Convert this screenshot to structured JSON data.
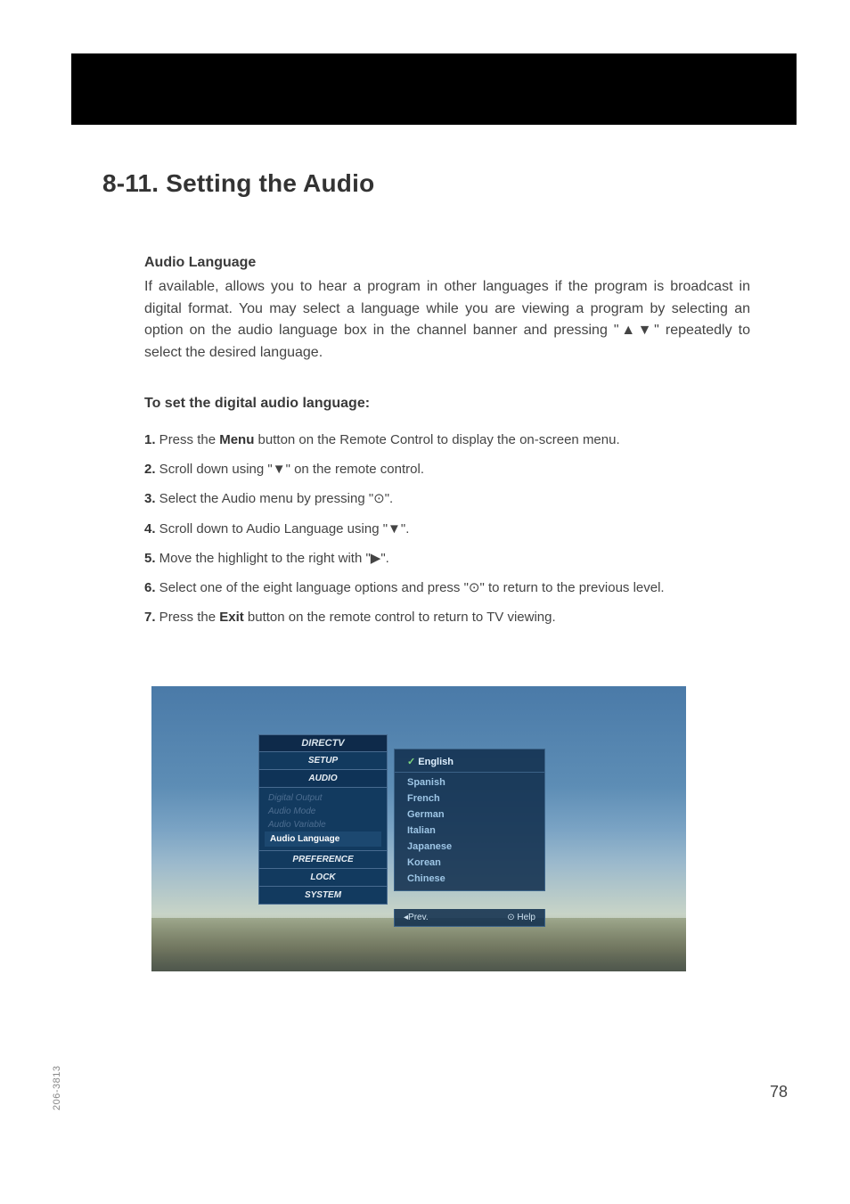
{
  "heading": "8-11. Setting the Audio",
  "section": {
    "title": "Audio Language",
    "para": "If available, allows you to hear a program in other languages if the program is broadcast in digital format.  You may select a language while you are viewing a program by selecting an option on the audio language box in the channel banner and pressing \"▲▼\" repeatedly to select the desired language.",
    "subhead": "To set the digital audio language:"
  },
  "steps": {
    "s1a": "1.",
    "s1b": " Press the ",
    "s1c": "Menu",
    "s1d": " button on the Remote Control to display the on-screen menu.",
    "s2a": "2.",
    "s2b": " Scroll down using \"▼\" on the remote control.",
    "s3a": "3.",
    "s3b": " Select the Audio menu by pressing \"⊙\".",
    "s4a": "4.",
    "s4b": " Scroll down to Audio Language using \"▼\".",
    "s5a": "5.",
    "s5b": " Move the highlight to the right with \"▶\".",
    "s6a": "6.",
    "s6b": " Select one of the eight language options and press \"⊙\" to return to the previous level.",
    "s7a": "7.",
    "s7b": " Press the ",
    "s7c": "Exit",
    "s7d": " button on the remote control to return to TV viewing."
  },
  "osd": {
    "menu": {
      "head": "DIRECTV",
      "setup": "SETUP",
      "audio": "AUDIO",
      "sub1": "Digital Output",
      "sub2": "Audio Mode",
      "sub3": "Audio Variable",
      "sub4": "Audio Language",
      "pref": "PREFERENCE",
      "lock": "LOCK",
      "system": "SYSTEM"
    },
    "lang": {
      "english": "English",
      "spanish": "Spanish",
      "french": "French",
      "german": "German",
      "italian": "Italian",
      "japanese": "Japanese",
      "korean": "Korean",
      "chinese": "Chinese"
    },
    "footer": {
      "prev": "◂Prev.",
      "help": "⊙ Help"
    }
  },
  "page_number": "78",
  "doc_id": "206-3813"
}
